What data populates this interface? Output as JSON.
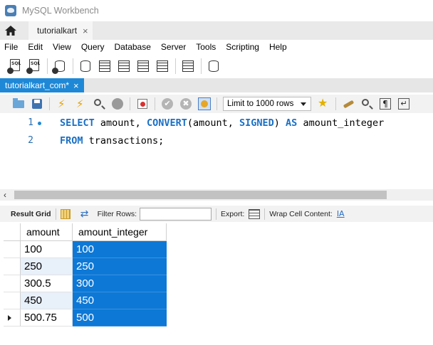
{
  "window": {
    "title": "MySQL Workbench"
  },
  "connection_tab": {
    "label": "tutorialkart",
    "close": "×"
  },
  "menu": [
    "File",
    "Edit",
    "View",
    "Query",
    "Database",
    "Server",
    "Tools",
    "Scripting",
    "Help"
  ],
  "query_tab": {
    "label": "tutorialkart_com*",
    "close": "×"
  },
  "editor_toolbar": {
    "limit_label": "Limit to 1000 rows"
  },
  "editor": {
    "lines": [
      {
        "number": "1",
        "has_execution_marker": true
      },
      {
        "number": "2",
        "has_execution_marker": false
      }
    ],
    "line1": {
      "kw_select": "SELECT",
      "t1": " amount, ",
      "kw_convert": "CONVERT",
      "t2": "(amount, ",
      "kw_signed": "SIGNED",
      "t3": ") ",
      "kw_as": "AS",
      "t4": " amount_integer"
    },
    "line2": {
      "kw_from": "FROM",
      "t1": " transactions;"
    }
  },
  "result_toolbar": {
    "result_grid_label": "Result Grid",
    "filter_rows_label": "Filter Rows:",
    "filter_value": "",
    "export_label": "Export:",
    "wrap_label": "Wrap Cell Content:",
    "wrap_icon_text": "IA"
  },
  "result_grid": {
    "columns": [
      "amount",
      "amount_integer"
    ],
    "rows": [
      [
        "100",
        "100"
      ],
      [
        "250",
        "250"
      ],
      [
        "300.5",
        "300"
      ],
      [
        "450",
        "450"
      ],
      [
        "500.75",
        "500"
      ]
    ],
    "current_row": 4,
    "selected_column": "amount_integer",
    "selection_color": "#0d78d6"
  },
  "colors": {
    "keyword": "#1a6fc4",
    "active_tab": "#1e88d6",
    "line_number": "#2a6fb0"
  }
}
